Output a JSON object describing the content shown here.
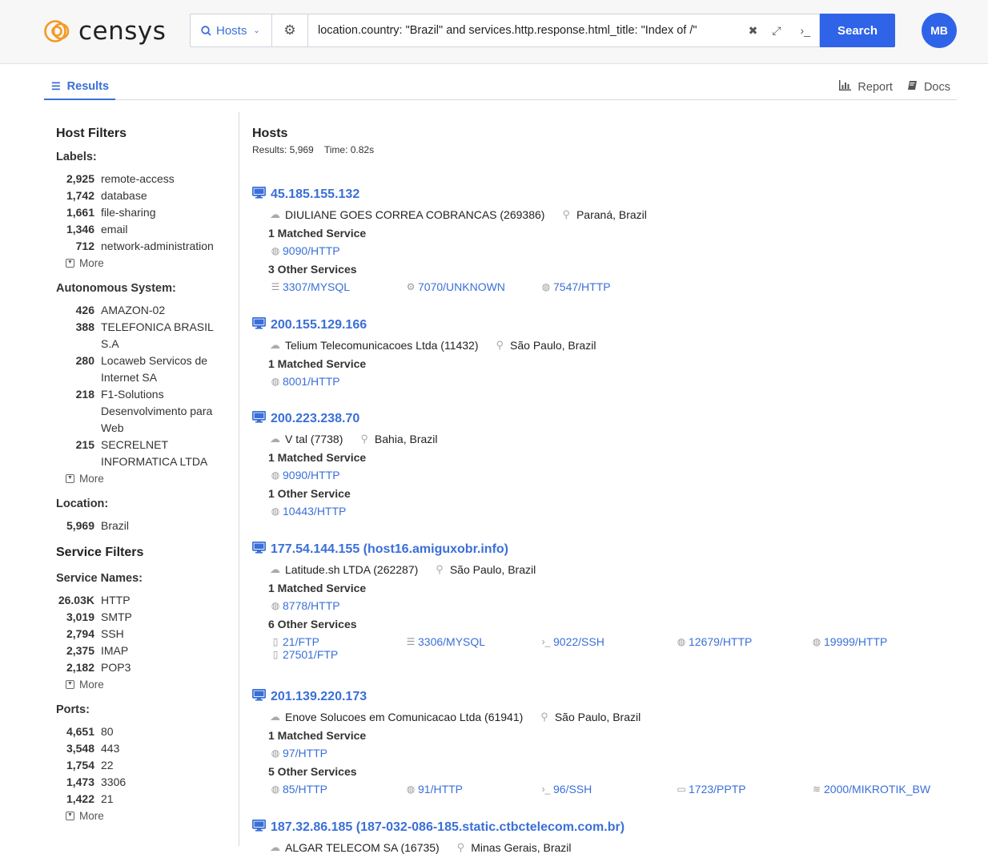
{
  "header": {
    "logo_text": "censys",
    "type_select": "Hosts",
    "query": "location.country: \"Brazil\" and services.http.response.html_title: \"Index of /\"",
    "search_label": "Search",
    "avatar_initials": "MB"
  },
  "tabs": {
    "results": "Results",
    "report": "Report",
    "docs": "Docs"
  },
  "sidebar": {
    "host_filters": "Host Filters",
    "labels_h": "Labels:",
    "labels": [
      {
        "count": "2,925",
        "name": "remote-access"
      },
      {
        "count": "1,742",
        "name": "database"
      },
      {
        "count": "1,661",
        "name": "file-sharing"
      },
      {
        "count": "1,346",
        "name": "email"
      },
      {
        "count": "712",
        "name": "network-administration"
      }
    ],
    "as_h": "Autonomous System:",
    "as": [
      {
        "count": "426",
        "name": "AMAZON-02"
      },
      {
        "count": "388",
        "name": "TELEFONICA BRASIL S.A"
      },
      {
        "count": "280",
        "name": "Locaweb Servicos de Internet SA"
      },
      {
        "count": "218",
        "name": "F1-Solutions Desenvolvimento para Web"
      },
      {
        "count": "215",
        "name": "SECRELNET INFORMATICA LTDA"
      }
    ],
    "location_h": "Location:",
    "location": [
      {
        "count": "5,969",
        "name": "Brazil"
      }
    ],
    "service_filters": "Service Filters",
    "svc_names_h": "Service Names:",
    "svc_names": [
      {
        "count": "26.03K",
        "name": "HTTP"
      },
      {
        "count": "3,019",
        "name": "SMTP"
      },
      {
        "count": "2,794",
        "name": "SSH"
      },
      {
        "count": "2,375",
        "name": "IMAP"
      },
      {
        "count": "2,182",
        "name": "POP3"
      }
    ],
    "ports_h": "Ports:",
    "ports": [
      {
        "count": "4,651",
        "name": "80"
      },
      {
        "count": "3,548",
        "name": "443"
      },
      {
        "count": "1,754",
        "name": "22"
      },
      {
        "count": "1,473",
        "name": "3306"
      },
      {
        "count": "1,422",
        "name": "21"
      }
    ],
    "more": "More"
  },
  "main": {
    "title": "Hosts",
    "results": "Results: 5,969",
    "time": "Time: 0.82s",
    "hosts": [
      {
        "title": "45.185.155.132",
        "as": "DIULIANE GOES CORREA COBRANCAS (269386)",
        "loc": "Paraná, Brazil",
        "matched_h": "1 Matched Service",
        "matched": [
          {
            "icon": "globe",
            "label": "9090/HTTP"
          }
        ],
        "other_h": "3 Other Services",
        "other": [
          {
            "icon": "db",
            "label": "3307/MYSQL"
          },
          {
            "icon": "gear",
            "label": "7070/UNKNOWN"
          },
          {
            "icon": "globe",
            "label": "7547/HTTP"
          }
        ]
      },
      {
        "title": "200.155.129.166",
        "as": "Telium Telecomunicacoes Ltda (11432)",
        "loc": "São Paulo, Brazil",
        "matched_h": "1 Matched Service",
        "matched": [
          {
            "icon": "globe",
            "label": "8001/HTTP"
          }
        ],
        "other_h": "",
        "other": []
      },
      {
        "title": "200.223.238.70",
        "as": "V tal (7738)",
        "loc": "Bahia, Brazil",
        "matched_h": "1 Matched Service",
        "matched": [
          {
            "icon": "globe",
            "label": "9090/HTTP"
          }
        ],
        "other_h": "1 Other Service",
        "other": [
          {
            "icon": "globe",
            "label": "10443/HTTP"
          }
        ]
      },
      {
        "title": "177.54.144.155 (host16.amiguxobr.info)",
        "as": "Latitude.sh LTDA (262287)",
        "loc": "São Paulo, Brazil",
        "matched_h": "1 Matched Service",
        "matched": [
          {
            "icon": "globe",
            "label": "8778/HTTP"
          }
        ],
        "other_h": "6 Other Services",
        "other": [
          {
            "icon": "file",
            "label": "21/FTP"
          },
          {
            "icon": "db",
            "label": "3306/MYSQL"
          },
          {
            "icon": "term",
            "label": "9022/SSH"
          },
          {
            "icon": "globe",
            "label": "12679/HTTP"
          },
          {
            "icon": "globe",
            "label": "19999/HTTP"
          },
          {
            "icon": "file",
            "label": "27501/FTP"
          }
        ]
      },
      {
        "title": "201.139.220.173",
        "as": "Enove Solucoes em Comunicacao Ltda (61941)",
        "loc": "São Paulo, Brazil",
        "matched_h": "1 Matched Service",
        "matched": [
          {
            "icon": "globe",
            "label": "97/HTTP"
          }
        ],
        "other_h": "5 Other Services",
        "other": [
          {
            "icon": "globe",
            "label": "85/HTTP"
          },
          {
            "icon": "globe",
            "label": "91/HTTP"
          },
          {
            "icon": "term",
            "label": "96/SSH"
          },
          {
            "icon": "monitor",
            "label": "1723/PPTP"
          },
          {
            "icon": "wifi",
            "label": "2000/MIKROTIK_BW"
          }
        ]
      },
      {
        "title": "187.32.86.185 (187-032-086-185.static.ctbctelecom.com.br)",
        "as": "ALGAR TELECOM SA (16735)",
        "loc": "Minas Gerais, Brazil",
        "matched_h": "",
        "matched": [],
        "other_h": "",
        "other": []
      }
    ]
  }
}
